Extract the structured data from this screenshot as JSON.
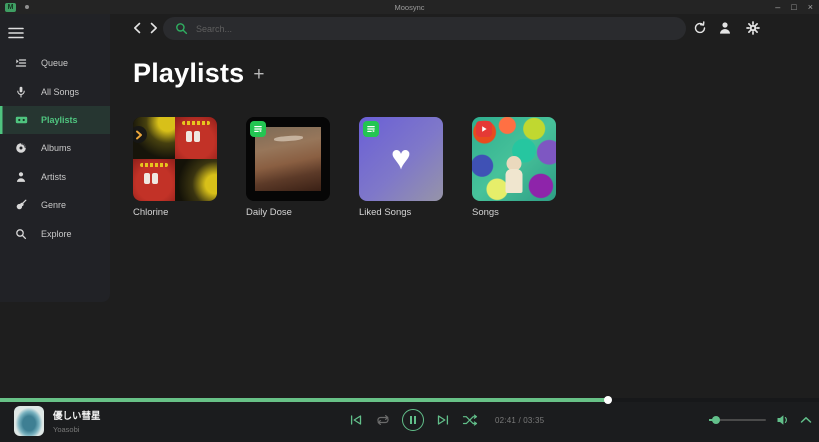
{
  "titlebar": {
    "app_title": "Moosync",
    "window_controls": {
      "minimize": "–",
      "maximize": "□",
      "close": "×"
    }
  },
  "topbar": {
    "search_placeholder": "Search..."
  },
  "sidebar": {
    "items": [
      {
        "label": "Queue",
        "icon": "queue-icon",
        "active": false
      },
      {
        "label": "All Songs",
        "icon": "microphone-icon",
        "active": false
      },
      {
        "label": "Playlists",
        "icon": "cassette-icon",
        "active": true
      },
      {
        "label": "Albums",
        "icon": "vinyl-icon",
        "active": false
      },
      {
        "label": "Artists",
        "icon": "artist-icon",
        "active": false
      },
      {
        "label": "Genre",
        "icon": "guitar-icon",
        "active": false
      },
      {
        "label": "Explore",
        "icon": "magnifier-icon",
        "active": false
      }
    ]
  },
  "content": {
    "page_title": "Playlists",
    "add_button": "+",
    "liked_heart": "♥",
    "playlists": [
      {
        "name": "Chlorine",
        "badge": "extension-provider"
      },
      {
        "name": "Daily Dose",
        "badge": "spotify-playlist"
      },
      {
        "name": "Liked Songs",
        "badge": "spotify-playlist"
      },
      {
        "name": "Songs",
        "badge": "youtube"
      }
    ]
  },
  "player": {
    "song_title": "優しい彗星",
    "artist": "Yoasobi",
    "current_time": "02:41",
    "total_time": "03:35",
    "time_display": "02:41 / 03:35",
    "progress_percent": 74.2,
    "volume_percent": 12,
    "playback_state": "playing"
  },
  "colors": {
    "accent_green": "#62bf8a",
    "selected_nav_green": "#4fc47f",
    "progress_green": "#68c287",
    "spotify_badge_green": "#23c552",
    "youtube_badge_red": "#e53935",
    "extension_badge_yellow": "#eda73c"
  }
}
